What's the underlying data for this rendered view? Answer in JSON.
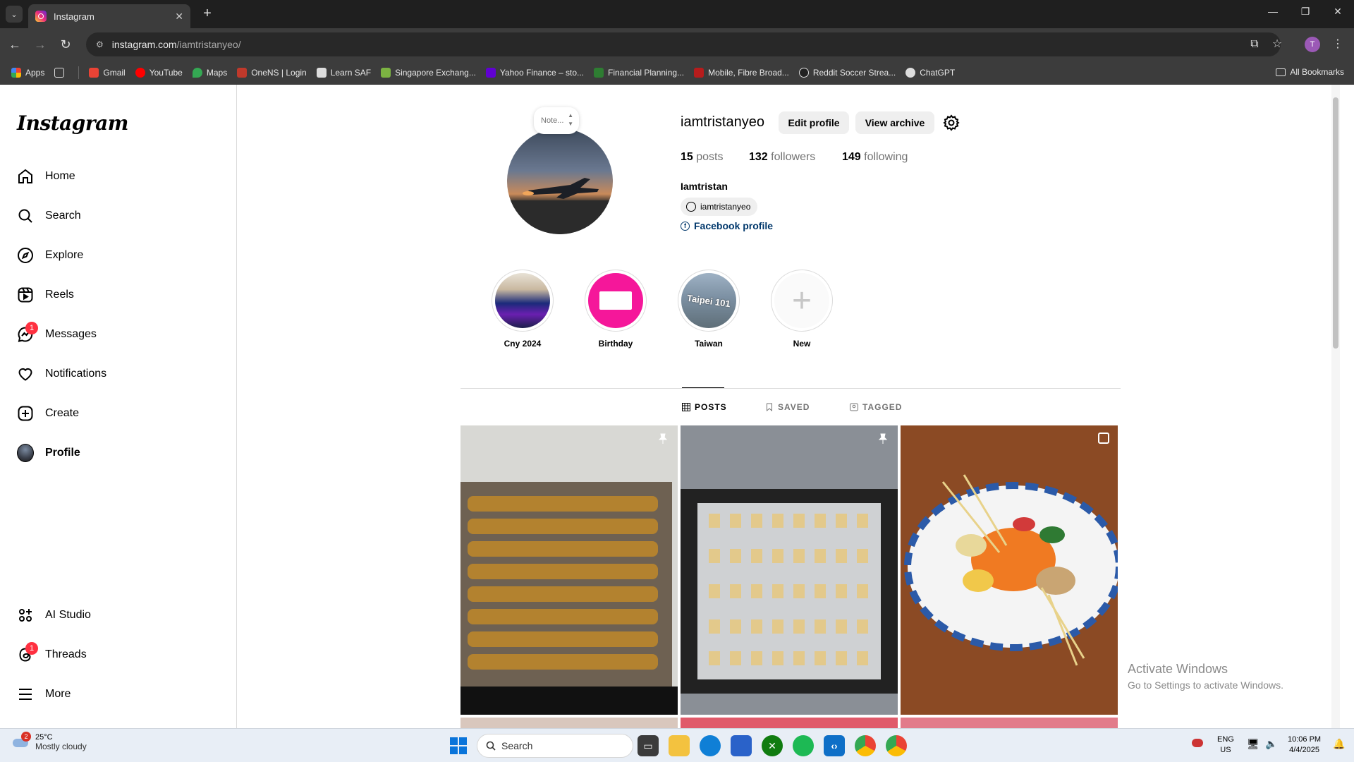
{
  "browser": {
    "tab_title": "Instagram",
    "new_tab": "+",
    "tab_close": "✕",
    "url_host": "instagram.com",
    "url_path": "/iamtristanyeo/",
    "profile_initial": "T",
    "bookmarks": [
      {
        "label": "Apps",
        "color": "#4285f4"
      },
      {
        "label": "Gmail",
        "color": "#ea4335"
      },
      {
        "label": "YouTube",
        "color": "#ff0000"
      },
      {
        "label": "Maps",
        "color": "#34a853"
      },
      {
        "label": "OneNS | Login",
        "color": "#c0392b"
      },
      {
        "label": "Learn SAF",
        "color": "#dddddd"
      },
      {
        "label": "Singapore Exchang...",
        "color": "#7cb342"
      },
      {
        "label": "Yahoo Finance – sto...",
        "color": "#6001d2"
      },
      {
        "label": "Financial Planning...",
        "color": "#2e7d32"
      },
      {
        "label": "Mobile, Fibre Broad...",
        "color": "#b71c1c"
      },
      {
        "label": "Reddit Soccer Strea...",
        "color": "#222222"
      },
      {
        "label": "ChatGPT",
        "color": "#dddddd"
      }
    ],
    "all_bookmarks": "All Bookmarks"
  },
  "sidebar": {
    "logo": "Instagram",
    "items": [
      {
        "label": "Home",
        "icon": "home-icon"
      },
      {
        "label": "Search",
        "icon": "search-icon"
      },
      {
        "label": "Explore",
        "icon": "compass-icon"
      },
      {
        "label": "Reels",
        "icon": "reels-icon"
      },
      {
        "label": "Messages",
        "icon": "messenger-icon",
        "badge": "1"
      },
      {
        "label": "Notifications",
        "icon": "heart-icon"
      },
      {
        "label": "Create",
        "icon": "plus-square-icon"
      },
      {
        "label": "Profile",
        "icon": "avatar"
      }
    ],
    "bottom_items": [
      {
        "label": "AI Studio",
        "icon": "ai-studio-icon"
      },
      {
        "label": "Threads",
        "icon": "threads-icon",
        "badge": "1"
      },
      {
        "label": "More",
        "icon": "hamburger-icon"
      }
    ]
  },
  "profile": {
    "note": "Note...",
    "username": "iamtristanyeo",
    "edit_profile": "Edit profile",
    "view_archive": "View archive",
    "posts_count": "15",
    "posts_label": "posts",
    "followers_count": "132",
    "followers_label": "followers",
    "following_count": "149",
    "following_label": "following",
    "full_name": "Iamtristan",
    "threads_handle": "iamtristanyeo",
    "facebook_link": "Facebook profile",
    "highlights": [
      {
        "label": "Cny 2024"
      },
      {
        "label": "Birthday"
      },
      {
        "label": "Taiwan",
        "overlay": "Taipei 101"
      },
      {
        "label": "New"
      }
    ],
    "tabs": [
      "POSTS",
      "SAVED",
      "TAGGED"
    ],
    "active_tab": "POSTS"
  },
  "activation": {
    "line1": "Activate Windows",
    "line2": "Go to Settings to activate Windows."
  },
  "taskbar": {
    "weather_badge": "2",
    "temperature": "25°C",
    "weather_desc": "Mostly cloudy",
    "search_placeholder": "Search",
    "language_1": "ENG",
    "language_2": "US",
    "time": "10:06 PM",
    "date": "4/4/2025"
  },
  "colors": {
    "instagram_link": "#00376b",
    "notification_badge": "#ff3040",
    "button_bg": "#efefef"
  }
}
